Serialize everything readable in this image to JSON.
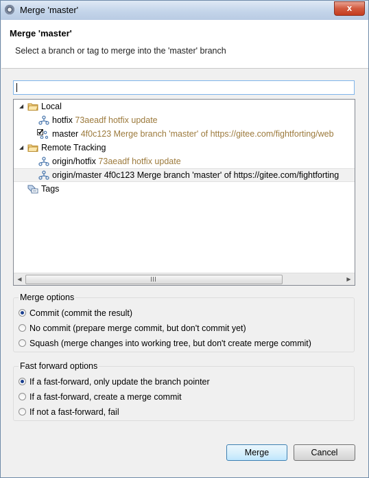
{
  "window": {
    "title": "Merge 'master'",
    "close_label": "x"
  },
  "header": {
    "title": "Merge 'master'",
    "description": "Select a branch or tag to merge into the 'master' branch"
  },
  "filter": {
    "value": ""
  },
  "tree": {
    "local_label": "Local",
    "local_items": [
      {
        "name": "hotfix",
        "detail": "73aeadf hotfix update"
      },
      {
        "name": "master",
        "detail": "4f0c123 Merge branch 'master' of https://gitee.com/fightforting/web"
      }
    ],
    "remote_label": "Remote Tracking",
    "remote_items": [
      {
        "name": "origin/hotfix",
        "detail": "73aeadf hotfix update"
      },
      {
        "name": "origin/master",
        "detail": "4f0c123 Merge branch 'master' of https://gitee.com/fightforting"
      }
    ],
    "tags_label": "Tags"
  },
  "merge_options": {
    "title": "Merge options",
    "options": [
      {
        "label": "Commit (commit the result)",
        "selected": true
      },
      {
        "label": "No commit (prepare merge commit, but don't commit yet)",
        "selected": false
      },
      {
        "label": "Squash (merge changes into working tree, but don't create merge commit)",
        "selected": false
      }
    ]
  },
  "ff_options": {
    "title": "Fast forward options",
    "options": [
      {
        "label": "If a fast-forward, only update the branch pointer",
        "selected": true
      },
      {
        "label": "If a fast-forward, create a merge commit",
        "selected": false
      },
      {
        "label": "If not a fast-forward, fail",
        "selected": false
      }
    ]
  },
  "buttons": {
    "merge": "Merge",
    "cancel": "Cancel"
  },
  "colors": {
    "detail_text": "#9c7a3c",
    "focus_border": "#7eb4ea",
    "default_button": "#3c7fb1"
  }
}
